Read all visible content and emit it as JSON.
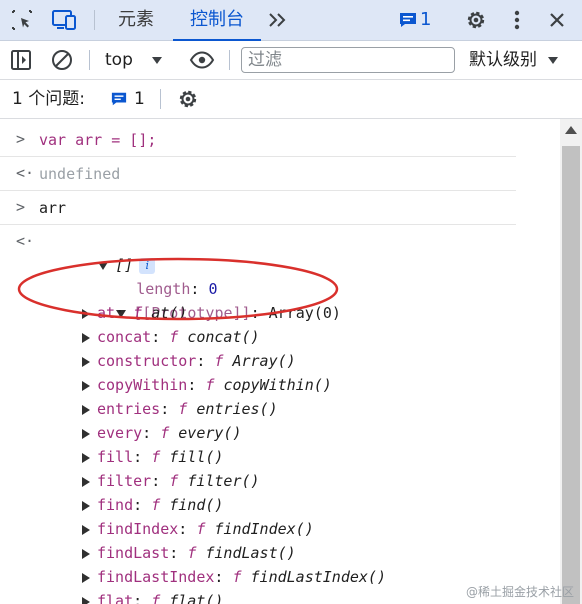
{
  "tabbar": {
    "tabs": [
      {
        "label": "元素"
      },
      {
        "label": "控制台"
      }
    ],
    "issues_count": "1"
  },
  "toolbar": {
    "context": "top",
    "filter_placeholder": "过滤",
    "level": "默认级别"
  },
  "issues": {
    "label": "1 个问题:",
    "count": "1"
  },
  "console": {
    "messages": [
      {
        "text": "var arr = [];"
      },
      {
        "text": "undefined"
      },
      {
        "text": "arr"
      }
    ],
    "result_label": "[]",
    "info_badge": "i",
    "length_key": "length",
    "length_value": "0",
    "prototype_key": "[[Prototype]]",
    "prototype_value": "Array(0)",
    "methods": [
      {
        "name": "at",
        "sig": "at()"
      },
      {
        "name": "concat",
        "sig": "concat()"
      },
      {
        "name": "constructor",
        "sig": "Array()"
      },
      {
        "name": "copyWithin",
        "sig": "copyWithin()"
      },
      {
        "name": "entries",
        "sig": "entries()"
      },
      {
        "name": "every",
        "sig": "every()"
      },
      {
        "name": "fill",
        "sig": "fill()"
      },
      {
        "name": "filter",
        "sig": "filter()"
      },
      {
        "name": "find",
        "sig": "find()"
      },
      {
        "name": "findIndex",
        "sig": "findIndex()"
      },
      {
        "name": "findLast",
        "sig": "findLast()"
      },
      {
        "name": "findLastIndex",
        "sig": "findLastIndex()"
      },
      {
        "name": "flat",
        "sig": "flat()"
      }
    ],
    "function_letter": "f"
  },
  "watermark": "@稀土掘金技术社区",
  "colors": {
    "accent": "#0b57d0",
    "annotation_ellipse": "#d9302c",
    "property_key": "#a0307e"
  }
}
